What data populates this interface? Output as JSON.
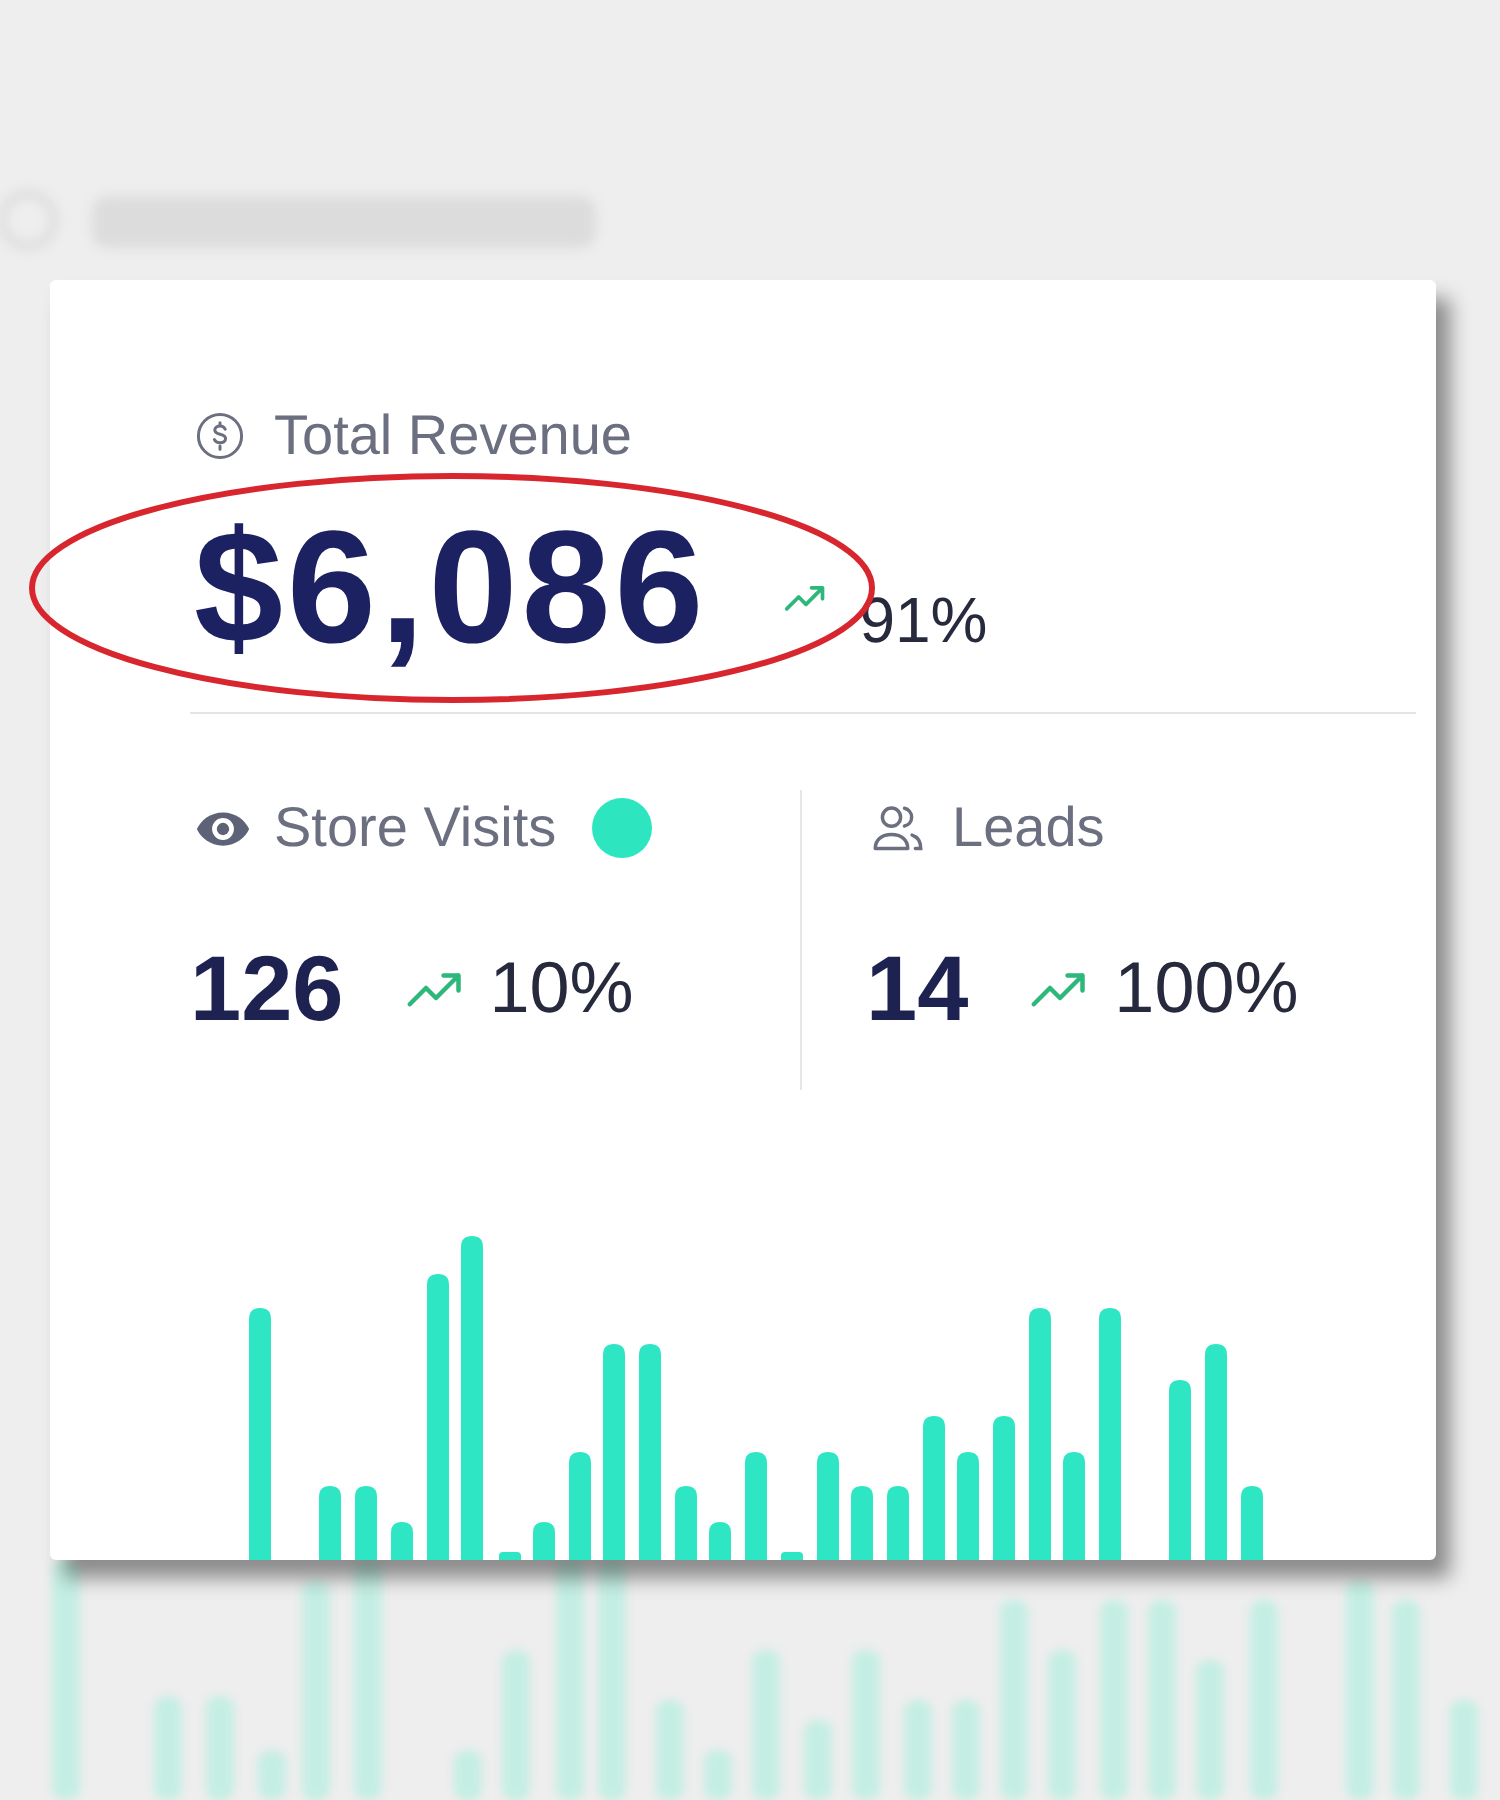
{
  "revenue": {
    "label": "Total Revenue",
    "amount": "$6,086",
    "change": "91%"
  },
  "metrics": [
    {
      "kind": "visits",
      "label": "Store Visits",
      "live": true,
      "value": "126",
      "change": "10%"
    },
    {
      "kind": "leads",
      "label": "Leads",
      "live": false,
      "value": "14",
      "change": "100%"
    }
  ]
}
